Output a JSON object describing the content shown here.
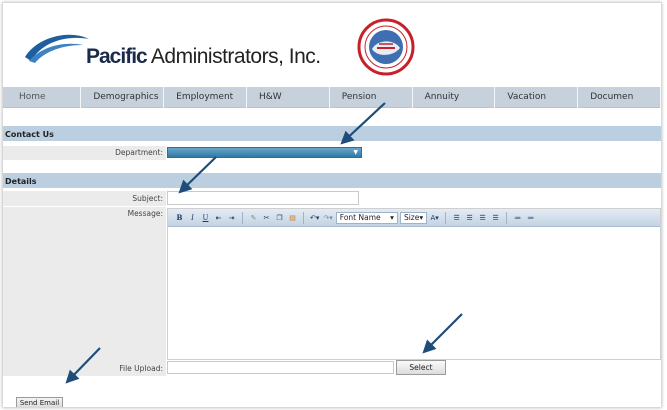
{
  "logo": {
    "bold": "Pacific",
    "light": " Administrators, Inc.",
    "brand_color": "#1a2a4a",
    "swoosh_color": "#1f5fa0"
  },
  "seal": {
    "icon": "union-seal-logo",
    "ring_color": "#c8202a"
  },
  "nav": {
    "items": [
      {
        "label": "Home"
      },
      {
        "label": "Demographics"
      },
      {
        "label": "Employment"
      },
      {
        "label": "H&W"
      },
      {
        "label": "Pension"
      },
      {
        "label": "Annuity"
      },
      {
        "label": "Vacation"
      },
      {
        "label": "Documen"
      }
    ]
  },
  "contact": {
    "section_title": "Contact Us",
    "department_label": "Department:",
    "department_value": ""
  },
  "details": {
    "section_title": "Details",
    "subject_label": "Subject:",
    "subject_value": "",
    "message_label": "Message:",
    "file_upload_label": "File Upload:",
    "file_upload_value": "",
    "select_button": "Select",
    "send_button": "Send Email"
  },
  "editor_toolbar": {
    "bold": "B",
    "italic": "I",
    "underline": "U",
    "font_name": "Font Name",
    "size": "Size",
    "font_color": "A"
  },
  "colors": {
    "nav_bg": "#c6d1dc",
    "section_bg": "#bccfe0",
    "dropdown_accent": "#2f7aa6",
    "annotation_arrow": "#1f4d7a"
  }
}
